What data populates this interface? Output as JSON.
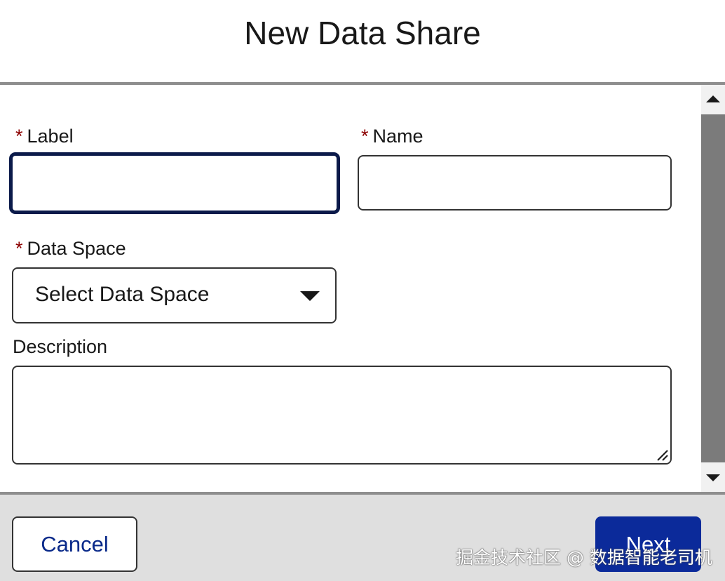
{
  "modal": {
    "title": "New Data Share"
  },
  "form": {
    "required_marker": "*",
    "label_field": {
      "label": "Label",
      "value": ""
    },
    "name_field": {
      "label": "Name",
      "value": ""
    },
    "data_space_field": {
      "label": "Data Space",
      "selected": "Select Data Space"
    },
    "description_field": {
      "label": "Description",
      "value": ""
    }
  },
  "footer": {
    "cancel_label": "Cancel",
    "next_label": "Next",
    "watermark": "掘金技术社区 @ 数据智能老司机"
  },
  "colors": {
    "primary_button": "#0b2a9a",
    "required": "#8c0000",
    "focus_border": "#0b1a4a",
    "footer_bg": "#dfdfdf"
  }
}
